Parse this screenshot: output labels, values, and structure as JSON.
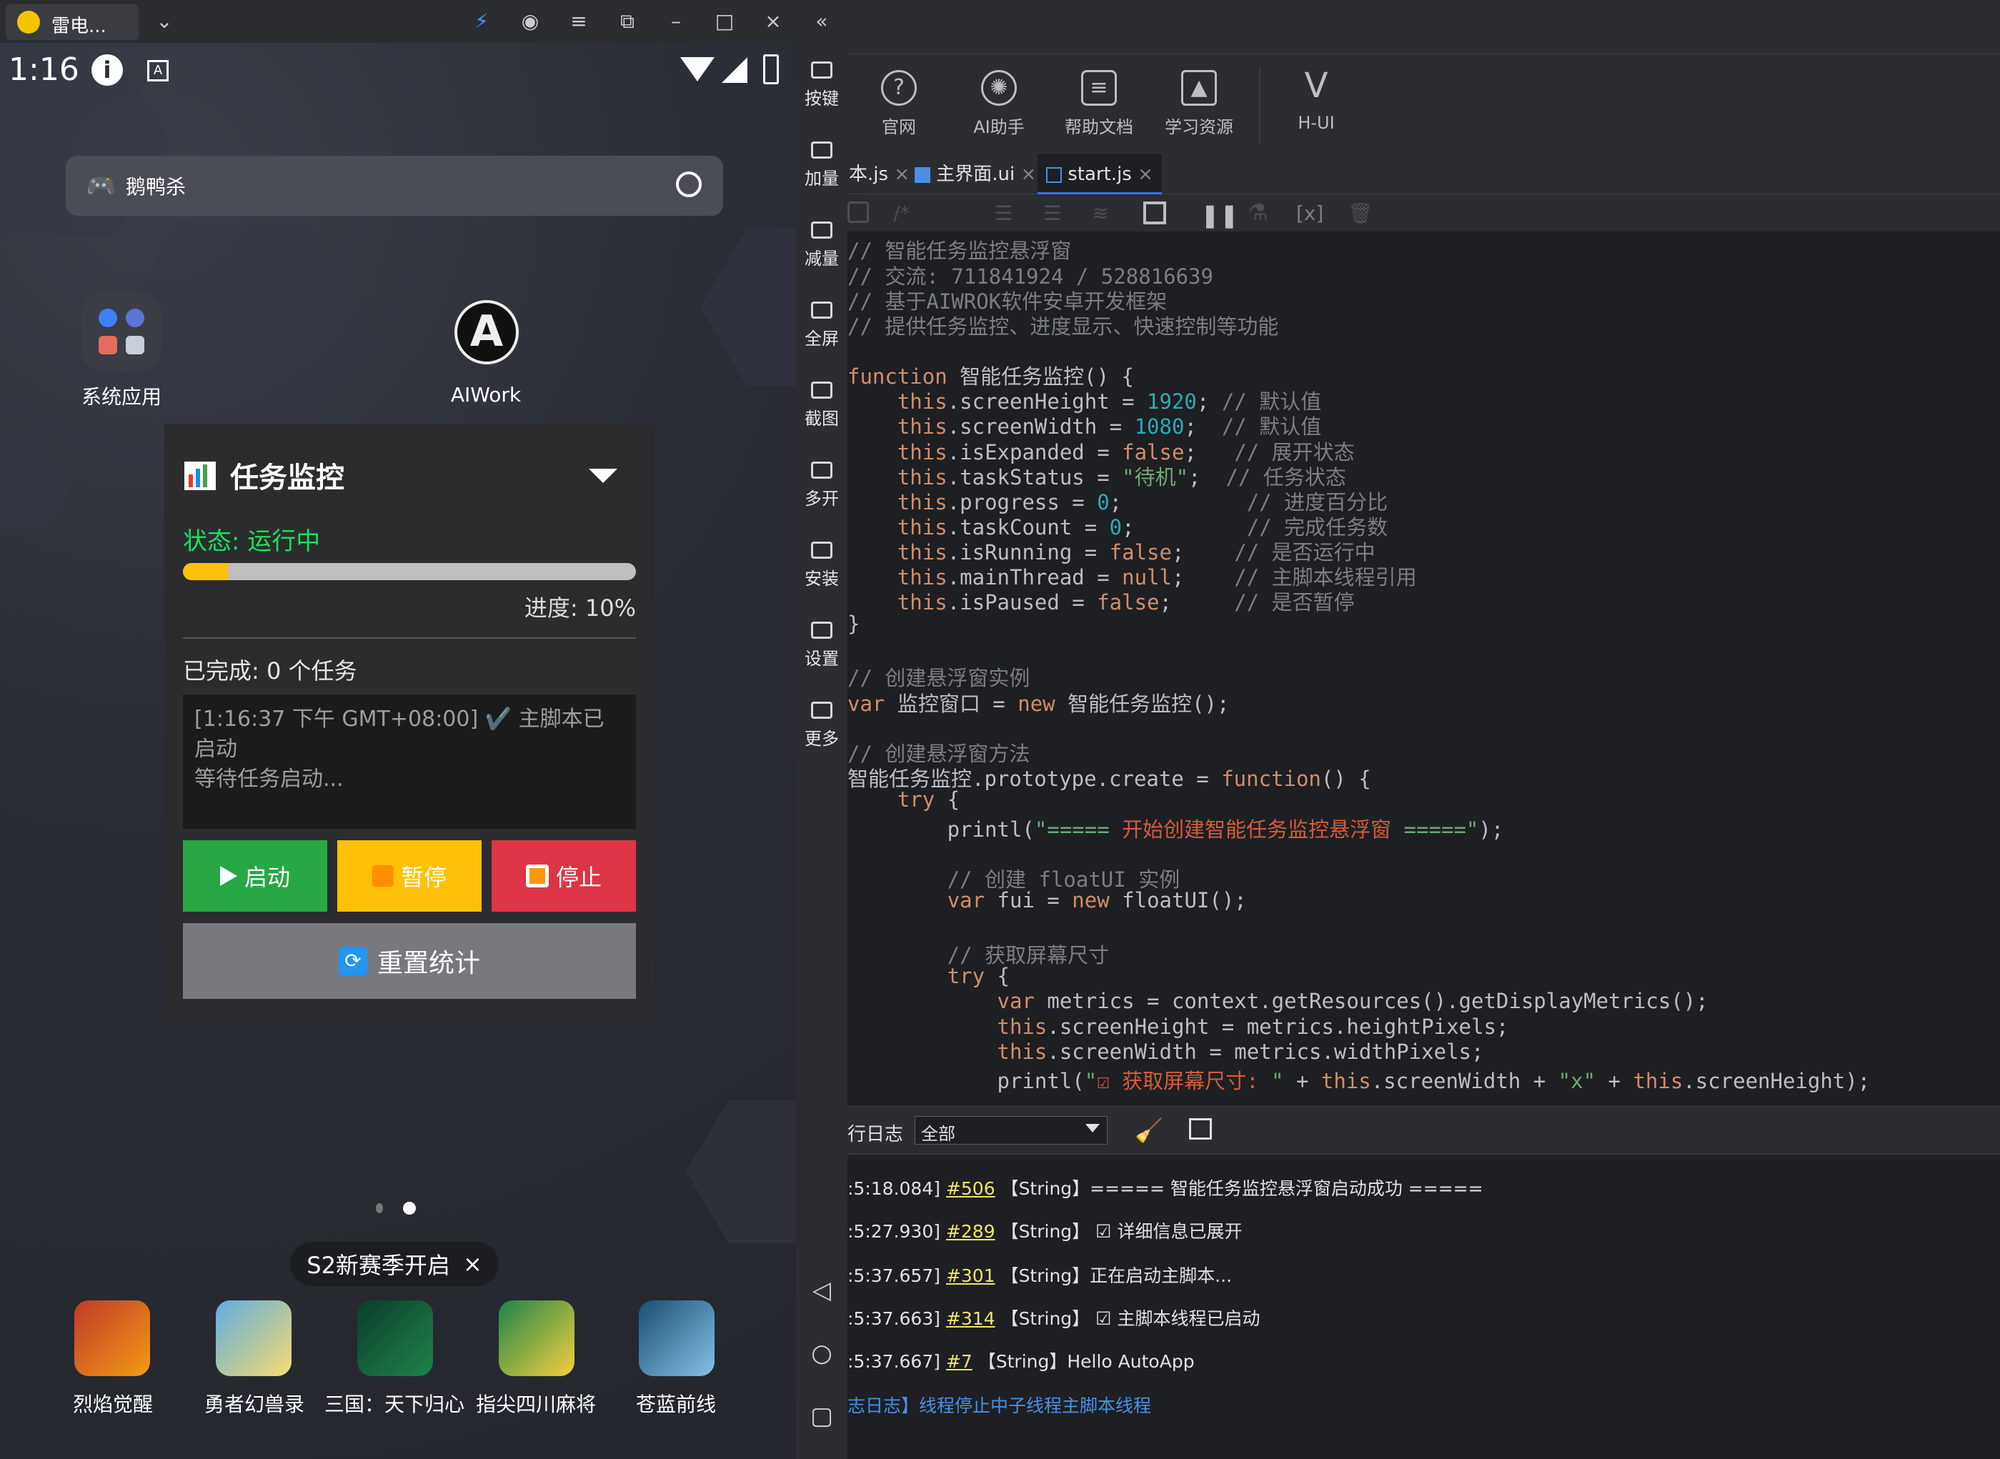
{
  "emulator": {
    "tab_title": "雷电...",
    "sidebar": [
      {
        "label": "按键"
      },
      {
        "label": "加量"
      },
      {
        "label": "减量"
      },
      {
        "label": "全屏"
      },
      {
        "label": "截图"
      },
      {
        "label": "多开"
      },
      {
        "label": "安装"
      },
      {
        "label": "设置"
      },
      {
        "label": "更多"
      }
    ]
  },
  "android": {
    "status_time": "1:16",
    "search_text": "鹅鸭杀",
    "apps": [
      {
        "label": "系统应用"
      },
      {
        "label": "AIWork"
      }
    ],
    "season_pill": "S2新赛季开启",
    "games": [
      {
        "label": "烈焰觉醒"
      },
      {
        "label": "勇者幻兽录"
      },
      {
        "label": "三国：天下归心"
      },
      {
        "label": "指尖四川麻将"
      },
      {
        "label": "苍蓝前线"
      }
    ]
  },
  "float_window": {
    "title": "任务监控",
    "status": "状态: 运行中",
    "progress": 0.1,
    "progress_text": "进度: 10%",
    "done_text": "已完成: 0 个任务",
    "log_line1": "[1:16:37 下午 GMT+08:00] ✔️ 主脚本已启动",
    "log_line2": "等待任务启动...",
    "btn_start": "启动",
    "btn_pause": "暂停",
    "btn_stop": "停止",
    "btn_reset": "重置统计",
    "colors": {
      "start": "#28a745",
      "pause": "#ffc107",
      "stop": "#dc3545"
    }
  },
  "ide": {
    "toolbar": [
      {
        "label": "官网",
        "icon": "question-icon"
      },
      {
        "label": "AI助手",
        "icon": "ai-icon"
      },
      {
        "label": "帮助文档",
        "icon": "doc-icon"
      },
      {
        "label": "学习资源",
        "icon": "graduation-cap-icon"
      },
      {
        "label": "H-UI",
        "icon": "vue-icon"
      }
    ],
    "tabs": [
      {
        "label": "本.js"
      },
      {
        "label": "主界面.ui"
      },
      {
        "label": "start.js"
      }
    ],
    "log_panel": {
      "title": "行日志",
      "filter": "全部",
      "lines": [
        {
          "time": ":5:18.084]",
          "id": "#506",
          "text": "【String】===== 智能任务监控悬浮窗启动成功 ====="
        },
        {
          "time": ":5:27.930]",
          "id": "#289",
          "text": "【String】 ☑ 详细信息已展开"
        },
        {
          "time": ":5:37.657]",
          "id": "#301",
          "text": "【String】正在启动主脚本..."
        },
        {
          "time": ":5:37.663]",
          "id": "#314",
          "text": "【String】 ☑ 主脚本线程已启动"
        },
        {
          "time": ":5:37.667]",
          "id": "#7",
          "text": "【String】Hello AutoApp"
        }
      ],
      "last_line": "志日志】线程停止中子线程主脚本线程"
    }
  }
}
